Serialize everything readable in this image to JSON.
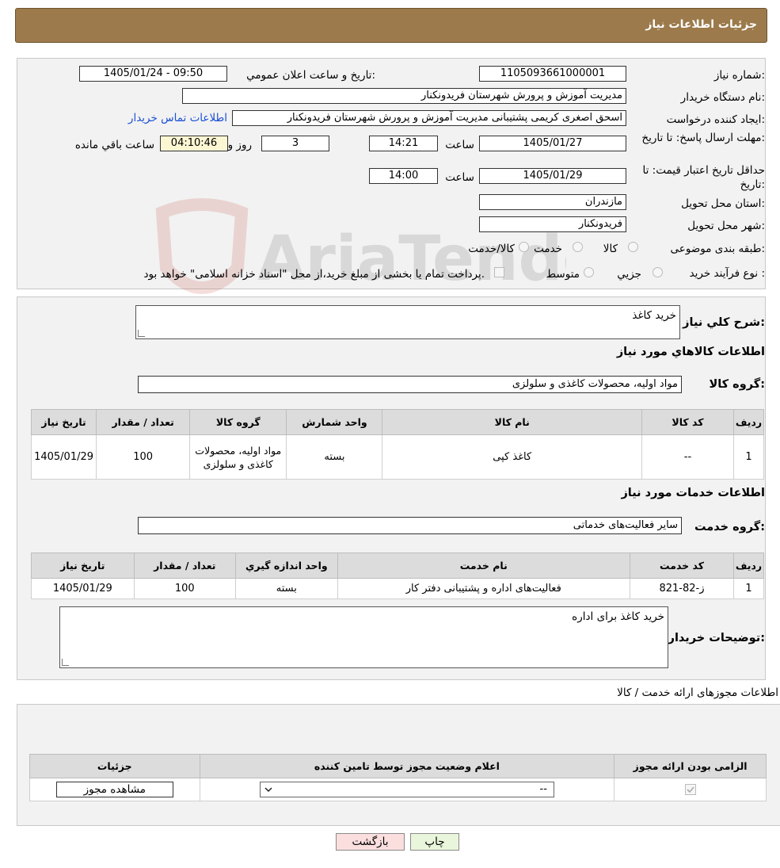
{
  "header": {
    "title": "جزئیات اطلاعات نیاز"
  },
  "watermark": {
    "text": "AriaTender.neT"
  },
  "info": {
    "need_number_label": "شماره نیاز:",
    "need_number": "1105093661000001",
    "announce_label": "تاريخ و ساعت اعلان عمومي:",
    "announce_value": "1405/01/24 - 09:50",
    "buyer_label": "نام دستگاه خريدار:",
    "buyer_value": "مدیریت آموزش و پرورش شهرستان فریدونکنار",
    "creator_label": "ايجاد کننده درخواست:",
    "creator_value": "اسحق اصغری کریمی پشتیبانی مدیریت آموزش و پرورش شهرستان فریدونکنار",
    "contact_link": "اطلاعات تماس خریدار",
    "deadline_label": "مهلت ارسال پاسخ: تا تاريخ:",
    "deadline_date": "1405/01/27",
    "time_label": "ساعت",
    "deadline_time": "14:21",
    "days_value": "3",
    "days_label": "روز و",
    "remaining_value": "04:10:46",
    "remaining_label": "ساعت باقي مانده",
    "validity_label": "حداقل تاريخ اعتبار قيمت: تا تاريخ:",
    "validity_date": "1405/01/29",
    "validity_time": "14:00",
    "province_label": "استان محل تحويل:",
    "province_value": "مازندران",
    "city_label": "شهر محل تحويل:",
    "city_value": "فریدونکنار",
    "category_label": "طبقه بندی موضوعی:",
    "category_options": [
      "كالا",
      "خدمت",
      "كالا/خدمت"
    ],
    "process_label": "نوع فرآيند خريد :",
    "process_options": [
      "جزيي",
      "متوسط"
    ],
    "payment_note": "پرداخت تمام يا بخشی از مبلغ خريد،از محل \"اسناد خزانه اسلامی\" خواهد بود."
  },
  "goods": {
    "description_label": "شرح کلي نياز:",
    "description_value": "خرید کاغذ",
    "section_title": "اطلاعات کالاهاي مورد نياز",
    "group_label": "گروه کالا:",
    "group_value": "مواد اولیه، محصولات کاغذی و سلولزی",
    "columns": [
      "رديف",
      "کد کالا",
      "نام کالا",
      "واحد شمارش",
      "گروه کالا",
      "تعداد / مقدار",
      "تاريخ نياز"
    ],
    "rows": [
      {
        "row": "1",
        "code": "--",
        "name": "کاغذ کپی",
        "unit": "بسته",
        "group": "مواد اولیه، محصولات کاغذی و سلولزی",
        "qty": "100",
        "date": "1405/01/29"
      }
    ]
  },
  "services": {
    "section_title": "اطلاعات خدمات مورد نياز",
    "group_label": "گروه خدمت:",
    "group_value": "سایر فعالیت‌های خدماتی",
    "columns": [
      "رديف",
      "کد خدمت",
      "نام خدمت",
      "واحد اندازه گيري",
      "تعداد / مقدار",
      "تاريخ نياز"
    ],
    "rows": [
      {
        "row": "1",
        "code": "ز-82-821",
        "name": "فعالیت‌های اداره و پشتیبانی دفتر کار",
        "unit": "بسته",
        "qty": "100",
        "date": "1405/01/29"
      }
    ],
    "notes_label": "توضيحات خريدار:",
    "notes_value": "خرید کاغذ برای اداره"
  },
  "permits": {
    "section_title": "اطلاعات مجوزهای ارائه خدمت / کالا",
    "columns": [
      "الزامی بودن ارائه مجوز",
      "اعلام وضعیت مجوز توسط تامین کننده",
      "جزئیات"
    ],
    "select_value": "--",
    "view_button": "مشاهده مجوز"
  },
  "footer": {
    "print_button": "چاپ",
    "back_button": "بازگشت"
  }
}
